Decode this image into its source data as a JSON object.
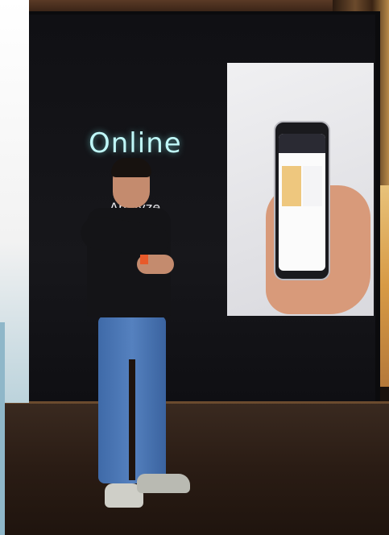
{
  "slide": {
    "headline": "Online",
    "subtitle": "Analyze"
  }
}
